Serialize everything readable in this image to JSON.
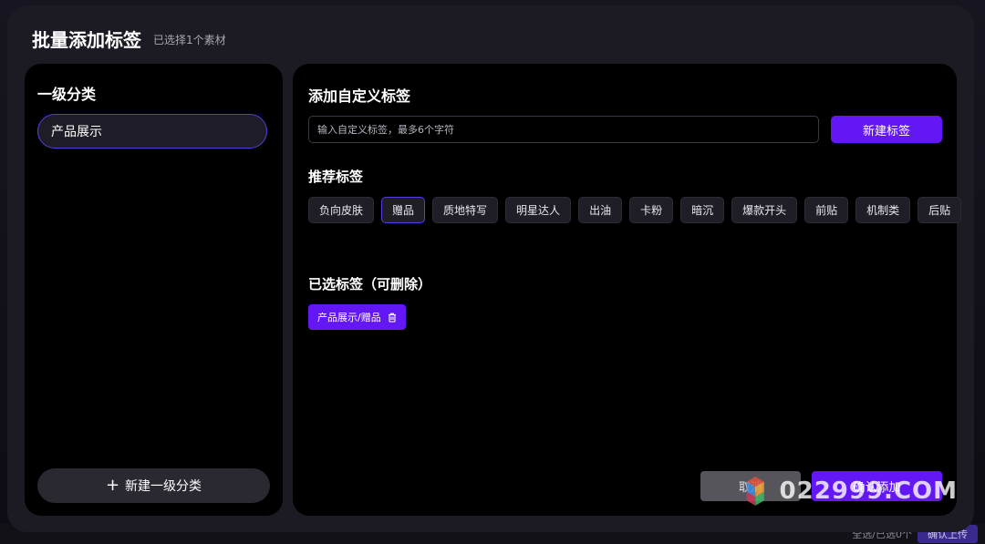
{
  "modal": {
    "title": "批量添加标签",
    "subtitle": "已选择1个素材"
  },
  "left_panel": {
    "title": "一级分类",
    "categories": [
      {
        "label": "产品展示",
        "selected": true
      }
    ],
    "new_category_label": "新建一级分类"
  },
  "right_panel": {
    "title": "添加自定义标签",
    "input": {
      "placeholder": "输入自定义标签，最多6个字符",
      "value": ""
    },
    "new_tag_button": "新建标签",
    "recommended": {
      "title": "推荐标签",
      "tags": [
        {
          "label": "负向皮肤",
          "active": false
        },
        {
          "label": "赠品",
          "active": true
        },
        {
          "label": "质地特写",
          "active": false
        },
        {
          "label": "明星达人",
          "active": false
        },
        {
          "label": "出油",
          "active": false
        },
        {
          "label": "卡粉",
          "active": false
        },
        {
          "label": "暗沉",
          "active": false
        },
        {
          "label": "爆款开头",
          "active": false
        },
        {
          "label": "前贴",
          "active": false
        },
        {
          "label": "机制类",
          "active": false
        },
        {
          "label": "后贴",
          "active": false
        }
      ]
    },
    "selected": {
      "title": "已选标签（可删除）",
      "chips": [
        "产品展示/赠品"
      ]
    },
    "cancel_button": "取消",
    "confirm_button": "确认添加"
  },
  "background": {
    "footer_count": "全选/已选0个",
    "footer_button": "确认上传"
  },
  "watermark": "022999.COM",
  "colors": {
    "accent": "#6417f5",
    "selected_border": "#5b3be0",
    "modal_bg": "#1c1b23",
    "panel_bg": "#000000"
  }
}
